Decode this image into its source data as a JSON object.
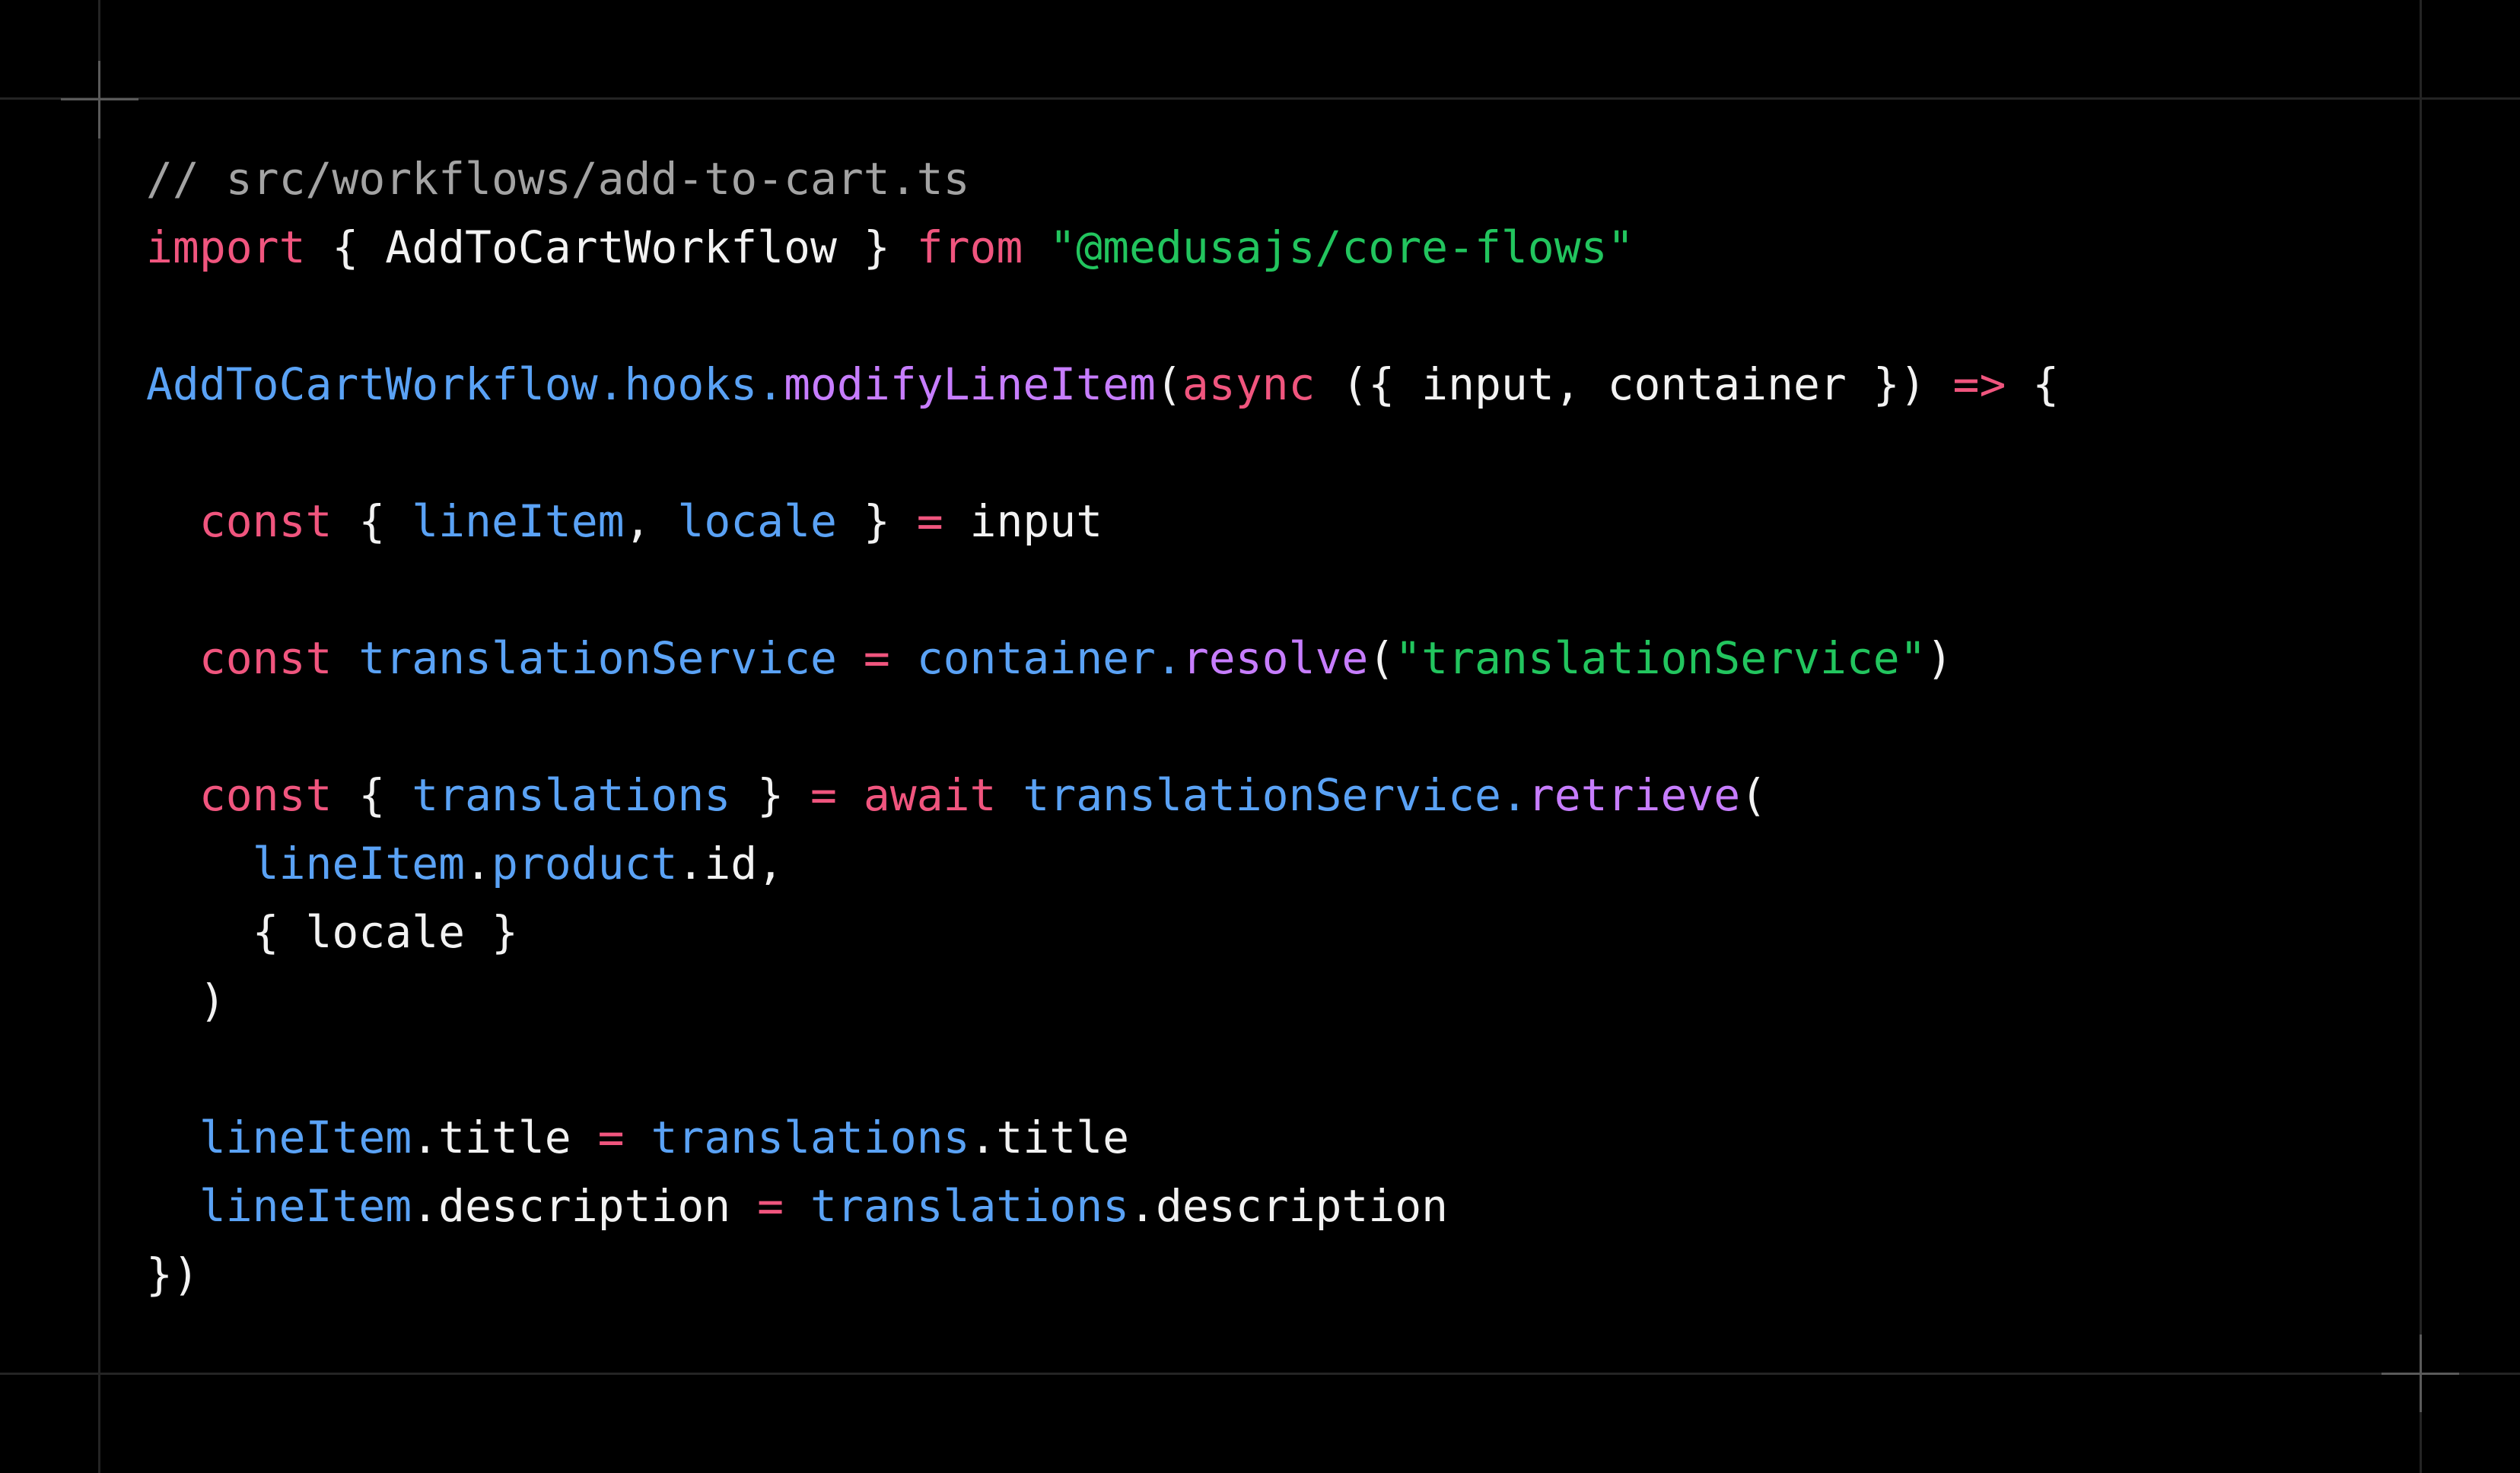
{
  "colors": {
    "background": "#000000",
    "comment": "#a3a3a3",
    "keyword": "#f0557e",
    "string": "#22c55e",
    "identifier": "#5aa2f5",
    "function": "#c77dff",
    "plain": "#f2f2f2",
    "guide_line": "#242424",
    "crosshair": "#5a5a5a"
  },
  "code": {
    "language": "typescript",
    "lines": [
      [
        {
          "t": "comment",
          "v": "// src/workflows/add-to-cart.ts"
        }
      ],
      [
        {
          "t": "keyword",
          "v": "import"
        },
        {
          "t": "plain",
          "v": " { AddToCartWorkflow } "
        },
        {
          "t": "keyword",
          "v": "from"
        },
        {
          "t": "plain",
          "v": " "
        },
        {
          "t": "string",
          "v": "\"@medusajs/core-flows\""
        }
      ],
      [],
      [
        {
          "t": "ident",
          "v": "AddToCartWorkflow.hooks."
        },
        {
          "t": "func",
          "v": "modifyLineItem"
        },
        {
          "t": "plain",
          "v": "("
        },
        {
          "t": "keyword",
          "v": "async"
        },
        {
          "t": "plain",
          "v": " ({ input, container }) "
        },
        {
          "t": "keyword",
          "v": "=>"
        },
        {
          "t": "plain",
          "v": " {"
        }
      ],
      [],
      [
        {
          "t": "plain",
          "v": "  "
        },
        {
          "t": "keyword",
          "v": "const"
        },
        {
          "t": "plain",
          "v": " { "
        },
        {
          "t": "ident",
          "v": "lineItem"
        },
        {
          "t": "plain",
          "v": ", "
        },
        {
          "t": "ident",
          "v": "locale"
        },
        {
          "t": "plain",
          "v": " } "
        },
        {
          "t": "keyword",
          "v": "="
        },
        {
          "t": "plain",
          "v": " input"
        }
      ],
      [],
      [
        {
          "t": "plain",
          "v": "  "
        },
        {
          "t": "keyword",
          "v": "const"
        },
        {
          "t": "plain",
          "v": " "
        },
        {
          "t": "ident",
          "v": "translationService"
        },
        {
          "t": "plain",
          "v": " "
        },
        {
          "t": "keyword",
          "v": "="
        },
        {
          "t": "plain",
          "v": " "
        },
        {
          "t": "ident",
          "v": "container."
        },
        {
          "t": "func",
          "v": "resolve"
        },
        {
          "t": "plain",
          "v": "("
        },
        {
          "t": "string",
          "v": "\"translationService\""
        },
        {
          "t": "plain",
          "v": ")"
        }
      ],
      [],
      [
        {
          "t": "plain",
          "v": "  "
        },
        {
          "t": "keyword",
          "v": "const"
        },
        {
          "t": "plain",
          "v": " { "
        },
        {
          "t": "ident",
          "v": "translations"
        },
        {
          "t": "plain",
          "v": " } "
        },
        {
          "t": "keyword",
          "v": "="
        },
        {
          "t": "plain",
          "v": " "
        },
        {
          "t": "keyword",
          "v": "await"
        },
        {
          "t": "plain",
          "v": " "
        },
        {
          "t": "ident",
          "v": "translationService."
        },
        {
          "t": "func",
          "v": "retrieve"
        },
        {
          "t": "plain",
          "v": "("
        }
      ],
      [
        {
          "t": "plain",
          "v": "    "
        },
        {
          "t": "ident",
          "v": "lineItem"
        },
        {
          "t": "plain",
          "v": "."
        },
        {
          "t": "ident",
          "v": "product"
        },
        {
          "t": "plain",
          "v": ".id,"
        }
      ],
      [
        {
          "t": "plain",
          "v": "    { locale }"
        }
      ],
      [
        {
          "t": "plain",
          "v": "  )"
        }
      ],
      [],
      [
        {
          "t": "plain",
          "v": "  "
        },
        {
          "t": "ident",
          "v": "lineItem"
        },
        {
          "t": "plain",
          "v": ".title "
        },
        {
          "t": "keyword",
          "v": "="
        },
        {
          "t": "plain",
          "v": " "
        },
        {
          "t": "ident",
          "v": "translations"
        },
        {
          "t": "plain",
          "v": ".title"
        }
      ],
      [
        {
          "t": "plain",
          "v": "  "
        },
        {
          "t": "ident",
          "v": "lineItem"
        },
        {
          "t": "plain",
          "v": ".description "
        },
        {
          "t": "keyword",
          "v": "="
        },
        {
          "t": "plain",
          "v": " "
        },
        {
          "t": "ident",
          "v": "translations"
        },
        {
          "t": "plain",
          "v": ".description"
        }
      ],
      [
        {
          "t": "plain",
          "v": "})"
        }
      ]
    ]
  }
}
